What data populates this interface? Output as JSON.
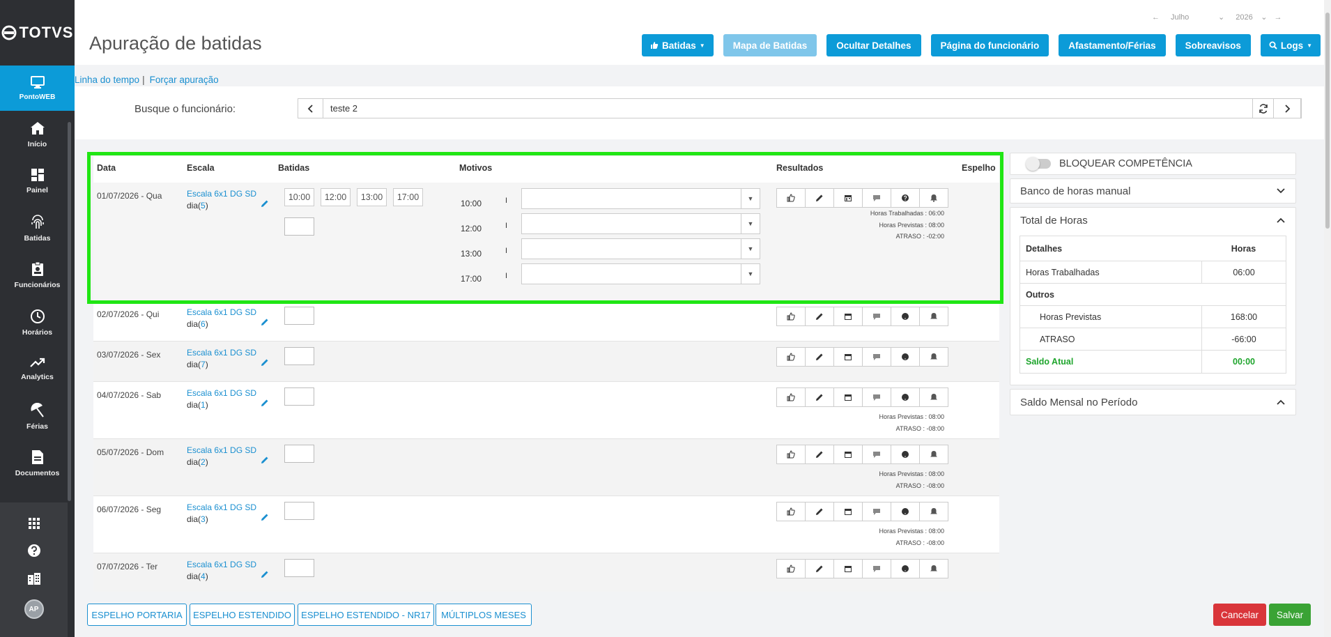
{
  "sidebar": {
    "logo": "TOTVS",
    "active_item": {
      "label": "PontoWEB",
      "icon": "monitor-icon"
    },
    "items": [
      {
        "label": "Início",
        "icon": "home-icon"
      },
      {
        "label": "Painel",
        "icon": "dashboard-icon"
      },
      {
        "label": "Batidas",
        "icon": "fingerprint-icon"
      },
      {
        "label": "Funcionários",
        "icon": "badge-icon"
      },
      {
        "label": "Horários",
        "icon": "clock-icon"
      },
      {
        "label": "Analytics",
        "icon": "trend-icon"
      },
      {
        "label": "Férias",
        "icon": "umbrella-icon"
      },
      {
        "label": "Documentos",
        "icon": "document-icon"
      }
    ],
    "avatar": "AP"
  },
  "header": {
    "title": "Apuração de batidas",
    "month": "Julho",
    "year": "2026",
    "buttons": {
      "batidas": "Batidas",
      "mapa": "Mapa de Batidas",
      "ocultar": "Ocultar Detalhes",
      "pagina": "Página do funcionário",
      "afastamento": "Afastamento/Férias",
      "sobreavisos": "Sobreavisos",
      "logs": "Logs"
    }
  },
  "links": {
    "linha": "Linha do tempo",
    "sep": "|",
    "forcar": "Forçar apuração"
  },
  "search": {
    "label": "Busque o funcionário:",
    "value": "teste 2"
  },
  "table": {
    "headers": {
      "data": "Data",
      "escala": "Escala",
      "batidas": "Batidas",
      "motivos": "Motivos",
      "resultados": "Resultados",
      "espelho": "Espelho"
    },
    "first": {
      "date": "01/07/2026 - Qua",
      "scale": "Escala 6x1 DG SD",
      "dia_prefix": "dia(",
      "dia_num": "5",
      "dia_suffix": ")",
      "times": [
        "10:00",
        "12:00",
        "13:00",
        "17:00"
      ],
      "motivos": [
        {
          "time": "10:00",
          "sep": "I"
        },
        {
          "time": "12:00",
          "sep": "I"
        },
        {
          "time": "13:00",
          "sep": "I"
        },
        {
          "time": "17:00",
          "sep": "I"
        }
      ],
      "results": [
        "Horas Trabalhadas : 06:00",
        "Horas Previstas : 08:00",
        "ATRASO : -02:00"
      ]
    },
    "rows": [
      {
        "date": "02/07/2026 - Qui",
        "scale": "Escala 6x1 DG SD",
        "dia_prefix": "dia(",
        "dia_num": "6",
        "dia_suffix": ")",
        "results": []
      },
      {
        "date": "03/07/2026 - Sex",
        "scale": "Escala 6x1 DG SD",
        "dia_prefix": "dia(",
        "dia_num": "7",
        "dia_suffix": ")",
        "results": []
      },
      {
        "date": "04/07/2026 - Sab",
        "scale": "Escala 6x1 DG SD",
        "dia_prefix": "dia(",
        "dia_num": "1",
        "dia_suffix": ")",
        "results": [
          "Horas Previstas : 08:00",
          "ATRASO : -08:00"
        ]
      },
      {
        "date": "05/07/2026 - Dom",
        "scale": "Escala 6x1 DG SD",
        "dia_prefix": "dia(",
        "dia_num": "2",
        "dia_suffix": ")",
        "results": [
          "Horas Previstas : 08:00",
          "ATRASO : -08:00"
        ]
      },
      {
        "date": "06/07/2026 - Seg",
        "scale": "Escala 6x1 DG SD",
        "dia_prefix": "dia(",
        "dia_num": "3",
        "dia_suffix": ")",
        "results": [
          "Horas Previstas : 08:00",
          "ATRASO : -08:00"
        ]
      },
      {
        "date": "07/07/2026 - Ter",
        "scale": "Escala 6x1 DG SD",
        "dia_prefix": "dia(",
        "dia_num": "4",
        "dia_suffix": ")",
        "results": []
      }
    ]
  },
  "right_panel": {
    "bloquear": "BLOQUEAR COMPETÊNCIA",
    "banco": "Banco de horas manual",
    "total": {
      "title": "Total de Horas",
      "col_detalhes": "Detalhes",
      "col_horas": "Horas",
      "trabalhadas_label": "Horas Trabalhadas",
      "trabalhadas_val": "06:00",
      "outros": "Outros",
      "previstas_label": "Horas Previstas",
      "previstas_val": "168:00",
      "atraso_label": "ATRASO",
      "atraso_val": "-66:00",
      "saldo_label": "Saldo Atual",
      "saldo_val": "00:00"
    },
    "saldo_mensal": "Saldo Mensal no Período"
  },
  "footer": {
    "portaria": "ESPELHO PORTARIA",
    "estendido": "ESPELHO ESTENDIDO",
    "nr17": "ESPELHO ESTENDIDO - NR17",
    "multiplos": "MÚLTIPLOS MESES",
    "cancelar": "Cancelar",
    "salvar": "Salvar"
  },
  "colors": {
    "primary": "#0c9bd8",
    "highlight": "#20e614",
    "cancel": "#d9353a",
    "save": "#3aa335",
    "saldo": "#1fa52d"
  }
}
